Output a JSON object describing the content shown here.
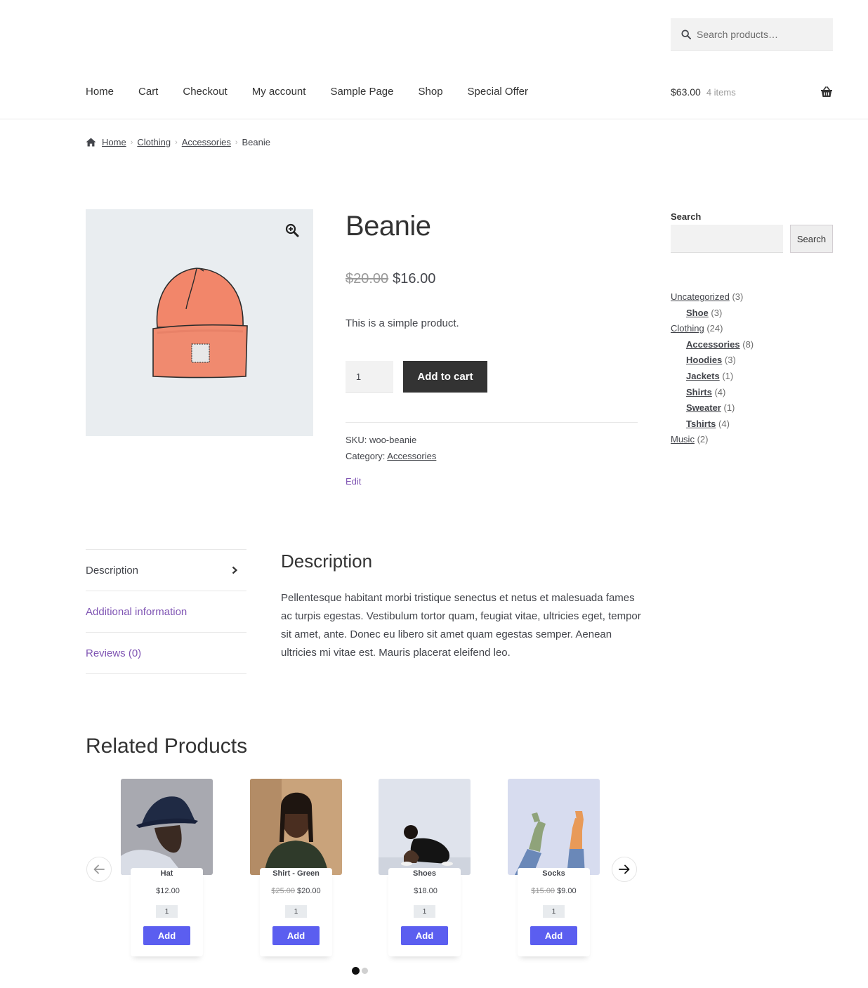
{
  "header": {
    "search_placeholder": "Search products…",
    "nav": [
      "Home",
      "Cart",
      "Checkout",
      "My account",
      "Sample Page",
      "Shop",
      "Special Offer"
    ],
    "cart_total": "$63.00",
    "cart_count": "4 items"
  },
  "breadcrumb": {
    "items": [
      "Home",
      "Clothing",
      "Accessories"
    ],
    "current": "Beanie"
  },
  "product": {
    "title": "Beanie",
    "old_price": "$20.00",
    "price": "$16.00",
    "short_description": "This is a simple product.",
    "quantity": "1",
    "add_to_cart_label": "Add to cart",
    "sku": "SKU: woo-beanie",
    "category_label": "Category:",
    "category": "Accessories",
    "edit_label": "Edit"
  },
  "sidebar": {
    "search_title": "Search",
    "search_button": "Search",
    "categories": [
      {
        "name": "Uncategorized",
        "count": "(3)",
        "level": 0
      },
      {
        "name": "Shoe",
        "count": "(3)",
        "level": 1
      },
      {
        "name": "Clothing",
        "count": "(24)",
        "level": 0
      },
      {
        "name": "Accessories",
        "count": "(8)",
        "level": 1
      },
      {
        "name": "Hoodies",
        "count": "(3)",
        "level": 1
      },
      {
        "name": "Jackets",
        "count": "(1)",
        "level": 1
      },
      {
        "name": "Shirts",
        "count": "(4)",
        "level": 1
      },
      {
        "name": "Sweater",
        "count": "(1)",
        "level": 1
      },
      {
        "name": "Tshirts",
        "count": "(4)",
        "level": 1
      },
      {
        "name": "Music",
        "count": "(2)",
        "level": 0
      }
    ]
  },
  "tabs": {
    "items": [
      "Description",
      "Additional information",
      "Reviews (0)"
    ],
    "active": 0,
    "panel_title": "Description",
    "panel_body": "Pellentesque habitant morbi tristique senectus et netus et malesuada fames ac turpis egestas. Vestibulum tortor quam, feugiat vitae, ultricies eget, tempor sit amet, ante. Donec eu libero sit amet quam egestas semper. Aenean ultricies mi vitae est. Mauris placerat eleifend leo."
  },
  "related": {
    "title": "Related Products",
    "add_label": "Add",
    "products": [
      {
        "name": "Hat",
        "old_price": "",
        "price": "$12.00",
        "qty": "1"
      },
      {
        "name": "Shirt - Green",
        "old_price": "$25.00",
        "price": "$20.00",
        "qty": "1"
      },
      {
        "name": "Shoes",
        "old_price": "",
        "price": "$18.00",
        "qty": "1"
      },
      {
        "name": "Socks",
        "old_price": "$15.00",
        "price": "$9.00",
        "qty": "1"
      }
    ],
    "active_page": 1,
    "page_count": 2
  },
  "colors": {
    "accent_purple": "#7f54b3",
    "button_dark": "#333333",
    "add_button_blue": "#5b5ef0",
    "image_bg": "#e9edf0"
  },
  "icons": [
    "search-icon",
    "basket-icon",
    "home-icon",
    "zoom-icon",
    "chevron-right-icon",
    "arrow-left-icon",
    "arrow-right-icon"
  ]
}
